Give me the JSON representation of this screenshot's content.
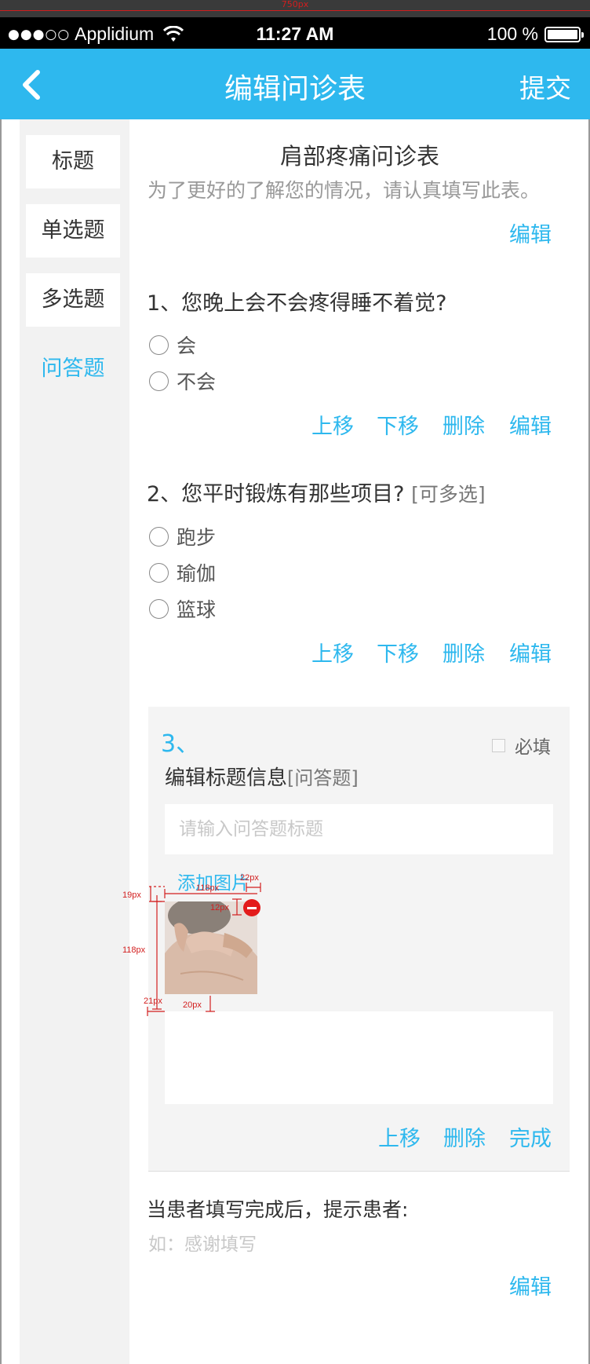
{
  "ruler": {
    "label": "750px"
  },
  "status_bar": {
    "carrier": "Applidium",
    "time": "11:27 AM",
    "battery": "100 %",
    "signal_dots": "●●●○○"
  },
  "nav": {
    "title": "编辑问诊表",
    "action": "提交",
    "back_icon": "chevron-left-icon"
  },
  "sidebar": {
    "items": [
      "标题",
      "单选题",
      "多选题",
      "问答题"
    ],
    "active_index": 3
  },
  "form": {
    "title": "肩部疼痛问诊表",
    "description": "为了更好的了解您的情况，请认真填写此表。",
    "edit_label": "编辑"
  },
  "questions": [
    {
      "text": "1、您晚上会不会疼得睡不着觉?",
      "hint": "",
      "options": [
        "会",
        "不会"
      ],
      "actions": [
        "上移",
        "下移",
        "删除",
        "编辑"
      ]
    },
    {
      "text": "2、您平时锻炼有那些项目?",
      "hint": "[可多选]",
      "options": [
        "跑步",
        "瑜伽",
        "篮球"
      ],
      "actions": [
        "上移",
        "下移",
        "删除",
        "编辑"
      ]
    }
  ],
  "editing": {
    "number": "3、",
    "required_label": "必填",
    "title": "编辑标题信息",
    "type_hint": "[问答题]",
    "placeholder": "请输入问答题标题",
    "add_image": "添加图片",
    "actions": [
      "上移",
      "删除",
      "完成"
    ]
  },
  "completion": {
    "label": "当患者填写完成后，提示患者:",
    "placeholder": "如：感谢填写",
    "edit_label": "编辑"
  },
  "dimension_annotations": [
    "19px",
    "118px",
    "22px",
    "12px",
    "118px",
    "21px",
    "20px"
  ],
  "colors": {
    "accent": "#2eb8ee",
    "remove": "#e31b1b",
    "annotation": "#d21e1e"
  }
}
